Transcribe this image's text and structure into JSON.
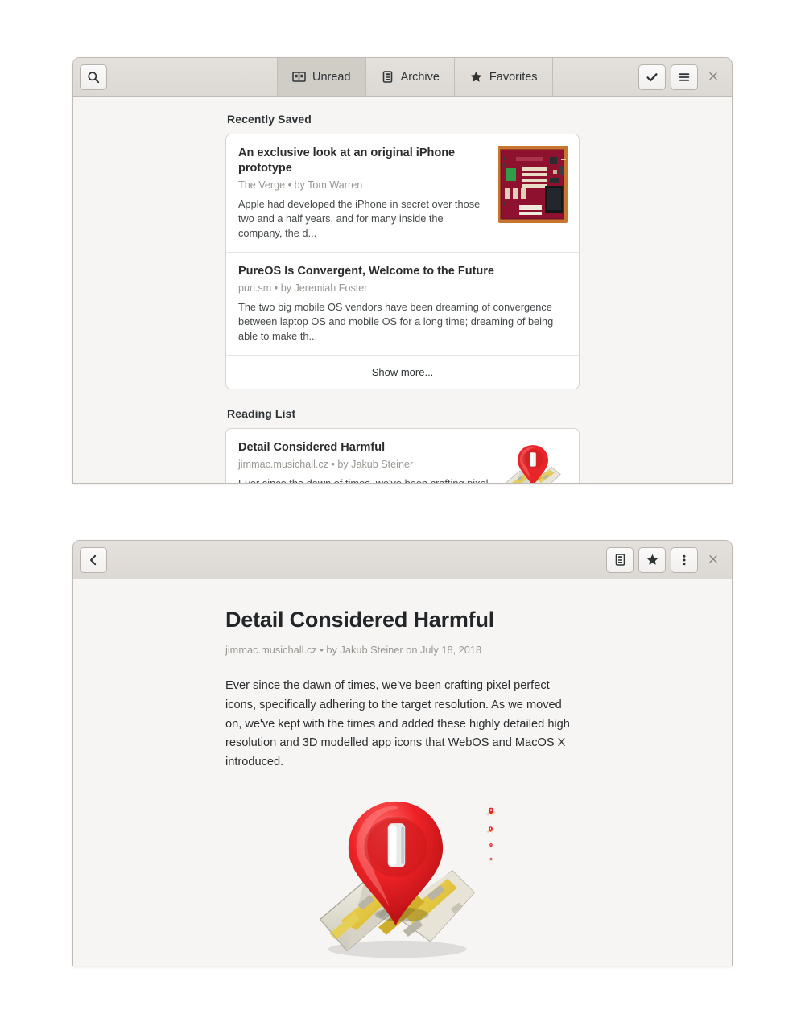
{
  "window_list": {
    "header": {
      "search_icon": "search-icon",
      "close_label": "×",
      "tabs": [
        {
          "label": "Unread",
          "icon": "open-book-icon",
          "selected": true
        },
        {
          "label": "Archive",
          "icon": "archive-box-icon",
          "selected": false
        },
        {
          "label": "Favorites",
          "icon": "star-icon",
          "selected": false
        }
      ],
      "actions": [
        {
          "name": "mark-read-button",
          "icon": "check-icon"
        },
        {
          "name": "menu-button",
          "icon": "hamburger-icon"
        }
      ]
    },
    "sections": [
      {
        "title": "Recently Saved",
        "items": [
          {
            "title": "An exclusive look at an original iPhone prototype",
            "meta": "The Verge • by Tom Warren",
            "excerpt": "Apple had developed the iPhone in secret over those two and a half years, and for many inside the company, the d...",
            "thumb": "iphone-prototype-pcb-photo"
          },
          {
            "title": "PureOS Is Convergent, Welcome to the Future",
            "meta": "puri.sm • by Jeremiah Foster",
            "excerpt": "The two big mobile OS vendors have been dreaming of convergence between laptop OS and mobile OS for a long time; dreaming of being able to make th...",
            "thumb": null
          }
        ],
        "show_more": "Show more..."
      },
      {
        "title": "Reading List",
        "items": [
          {
            "title": "Detail Considered Harmful",
            "meta": "jimmac.musichall.cz • by Jakub Steiner",
            "excerpt": "Ever since the dawn of times, we've been crafting pixel perfect icons, specifically adhering to the target resolution...",
            "thumb": "map-pin-icon-illustration"
          }
        ],
        "show_more": null
      }
    ]
  },
  "window_article": {
    "header": {
      "back_icon": "chevron-left-icon",
      "close_label": "×",
      "actions": [
        {
          "name": "archive-button",
          "icon": "archive-box-icon"
        },
        {
          "name": "favorite-button",
          "icon": "star-icon"
        },
        {
          "name": "overflow-menu-button",
          "icon": "three-dots-vertical-icon"
        }
      ]
    },
    "title": "Detail Considered Harmful",
    "meta": "jimmac.musichall.cz • by Jakub Steiner on July 18, 2018",
    "body": "Ever since the dawn of times, we've been crafting pixel perfect icons, specifically adhering to the target resolution. As we moved on, we've kept with the times and added these highly detailed high resolution and 3D modelled app icons that WebOS and MacOS X introduced.",
    "figure": {
      "name": "map-pin-on-folded-map-illustration",
      "scaled_copies": 4
    },
    "icon_strip": {
      "rows": 2,
      "per_row": 22
    }
  },
  "colors": {
    "window_bg": "#f6f5f4",
    "headerbar_top": "#e4e1dd",
    "headerbar_bottom": "#dcd8d3",
    "border": "#bfbab3",
    "tab_selected": "#d0ccc6",
    "card_bg": "#ffffff",
    "card_border": "#d8d4d0",
    "text_primary": "#2b2b2b",
    "text_dim": "#9a9792",
    "pin_red": "#e8262a",
    "map_yellow": "#e6c84b",
    "page_bg": "#ffffff"
  }
}
